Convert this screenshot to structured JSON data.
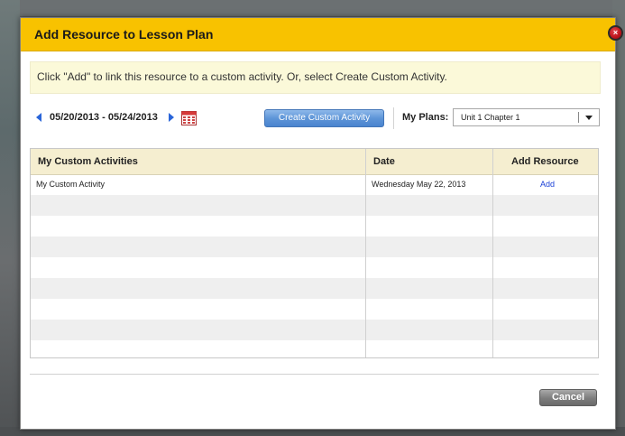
{
  "dialog": {
    "title": "Add Resource to Lesson Plan",
    "close_label": "×",
    "info_text": "Click \"Add\" to link this resource to a custom activity. Or, select Create Custom Activity."
  },
  "toolbar": {
    "date_range": "05/20/2013 - 05/24/2013",
    "create_button_label": "Create Custom Activity",
    "plans_label": "My Plans:",
    "plans_selected": "Unit 1 Chapter 1"
  },
  "table": {
    "columns": [
      "My Custom Activities",
      "Date",
      "Add Resource"
    ],
    "rows": [
      {
        "activity": "My Custom Activity",
        "date": "Wednesday May 22, 2013",
        "action": "Add"
      }
    ]
  },
  "footer": {
    "cancel_label": "Cancel"
  },
  "colors": {
    "header_bg": "#f8c200",
    "info_bg": "#fbf9d9",
    "table_head_bg": "#f5eed0",
    "link": "#1a3fd6",
    "accent_blue": "#2a65d9"
  },
  "icons": {
    "close": "close-icon",
    "prev": "chevron-left-icon",
    "next": "chevron-right-icon",
    "calendar": "calendar-icon",
    "dropdown": "chevron-down-icon"
  }
}
